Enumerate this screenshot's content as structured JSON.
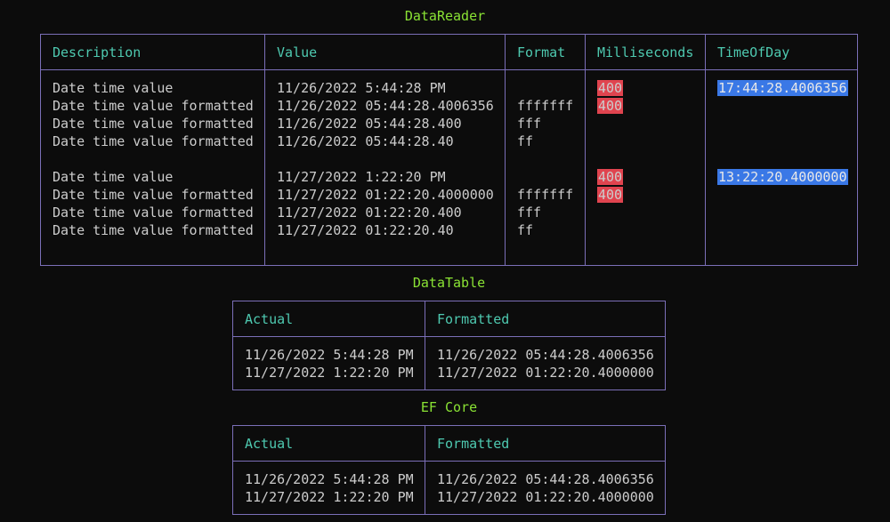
{
  "datareader": {
    "title": "DataReader",
    "headers": [
      "Description",
      "Value",
      "Format",
      "Milliseconds",
      "TimeOfDay"
    ],
    "rows": [
      {
        "description": "Date time value",
        "value": "11/26/2022 5:44:28 PM",
        "format": "",
        "ms": "400",
        "tod": "17:44:28.4006356"
      },
      {
        "description": "Date time value formatted",
        "value": "11/26/2022 05:44:28.4006356",
        "format": "fffffff",
        "ms": "400",
        "tod": ""
      },
      {
        "description": "Date time value formatted",
        "value": "11/26/2022 05:44:28.400",
        "format": "fff",
        "ms": "",
        "tod": ""
      },
      {
        "description": "Date time value formatted",
        "value": "11/26/2022 05:44:28.40",
        "format": "ff",
        "ms": "",
        "tod": ""
      },
      {
        "description": "Date time value",
        "value": "11/27/2022 1:22:20 PM",
        "format": "",
        "ms": "400",
        "tod": "13:22:20.4000000"
      },
      {
        "description": "Date time value formatted",
        "value": "11/27/2022 01:22:20.4000000",
        "format": "fffffff",
        "ms": "400",
        "tod": ""
      },
      {
        "description": "Date time value formatted",
        "value": "11/27/2022 01:22:20.400",
        "format": "fff",
        "ms": "",
        "tod": ""
      },
      {
        "description": "Date time value formatted",
        "value": "11/27/2022 01:22:20.40",
        "format": "ff",
        "ms": "",
        "tod": ""
      }
    ]
  },
  "datatable": {
    "title": "DataTable",
    "headers": [
      "Actual",
      "Formatted"
    ],
    "rows": [
      {
        "actual": "11/26/2022 5:44:28 PM",
        "formatted": "11/26/2022 05:44:28.4006356"
      },
      {
        "actual": "11/27/2022 1:22:20 PM",
        "formatted": "11/27/2022 01:22:20.4000000"
      }
    ]
  },
  "efcore": {
    "title": "EF Core",
    "headers": [
      "Actual",
      "Formatted"
    ],
    "rows": [
      {
        "actual": "11/26/2022 5:44:28 PM",
        "formatted": "11/26/2022 05:44:28.4006356"
      },
      {
        "actual": "11/27/2022 1:22:20 PM",
        "formatted": "11/27/2022 01:22:20.4000000"
      }
    ]
  },
  "colors": {
    "background": "#0c0c0c",
    "title": "#8ae234",
    "header": "#4ec9b0",
    "border": "#7b6fb8",
    "text": "#cccccc",
    "milliseconds_highlight": "#e0444f",
    "timeofday_highlight": "#3a78e6"
  }
}
